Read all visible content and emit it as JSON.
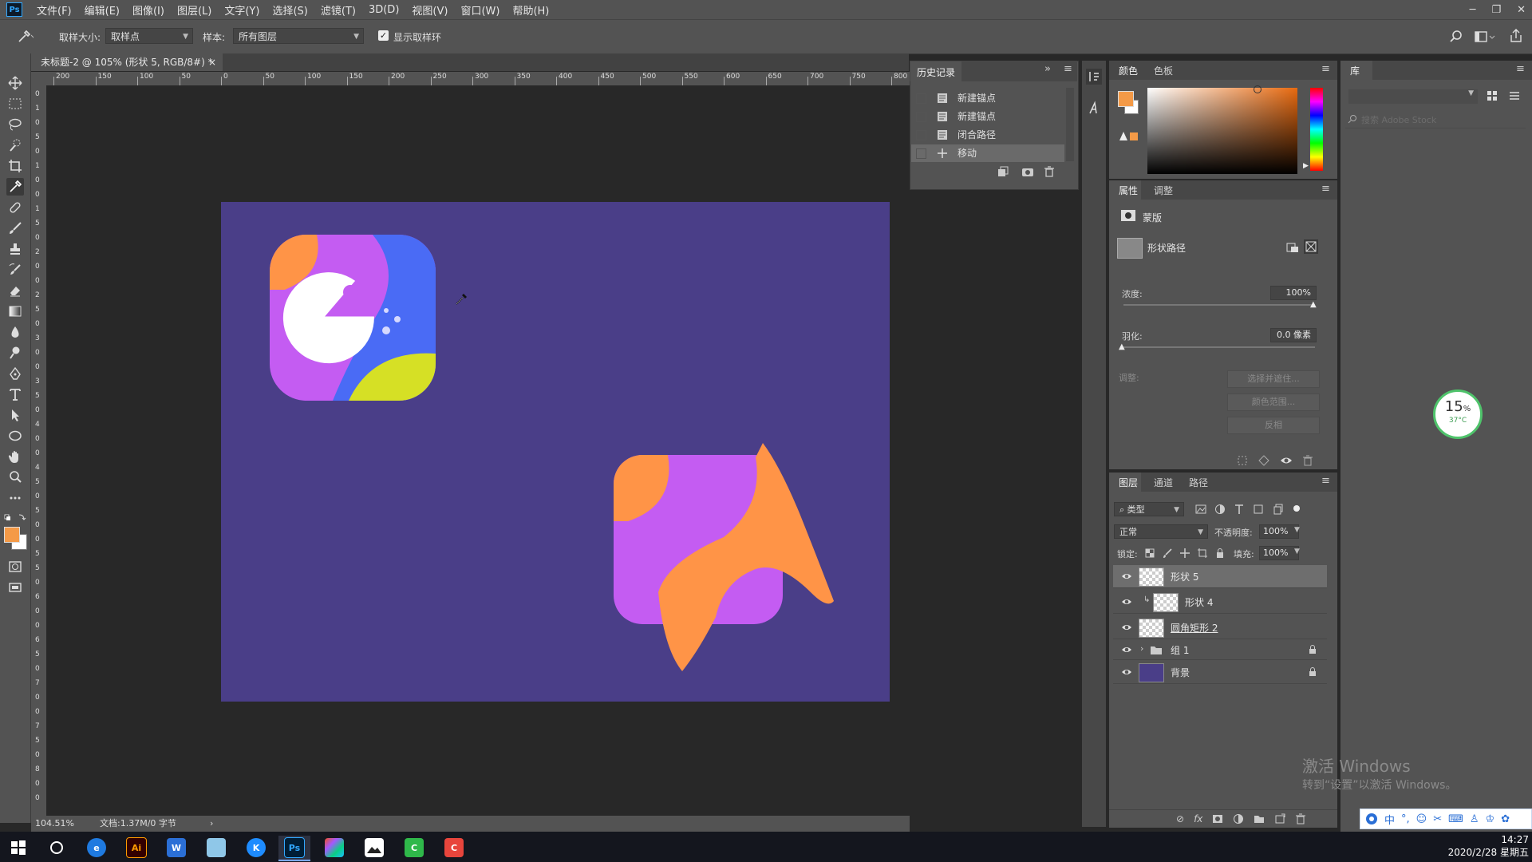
{
  "app": {
    "logo": "Ps"
  },
  "menu": [
    "文件(F)",
    "编辑(E)",
    "图像(I)",
    "图层(L)",
    "文字(Y)",
    "选择(S)",
    "滤镜(T)",
    "3D(D)",
    "视图(V)",
    "窗口(W)",
    "帮助(H)"
  ],
  "window_controls": {
    "minimize": "─",
    "restore": "❐",
    "close": "✕"
  },
  "options": {
    "sample_size_label": "取样大小:",
    "sample_size_value": "取样点",
    "sample_label": "样本:",
    "sample_value": "所有图层",
    "show_ring_label": "显示取样环",
    "show_ring_checked": true
  },
  "document": {
    "tab_title": "未标题-2 @ 105% (形状 5, RGB/8#) *",
    "tab_close": "×",
    "zoom": "104.51%",
    "doc_info": "文档:1.37M/0 字节",
    "status_arrow": "›"
  },
  "ruler": {
    "h_ticks": [
      "200",
      "150",
      "100",
      "50",
      "0",
      "50",
      "100",
      "150",
      "200",
      "250",
      "300",
      "350",
      "400",
      "450",
      "500",
      "550",
      "600",
      "650",
      "700",
      "750",
      "800"
    ],
    "v_ticks": [
      "0",
      "1",
      "0",
      "5",
      "0",
      "1",
      "0",
      "0",
      "1",
      "5",
      "0",
      "2",
      "0",
      "0",
      "2",
      "5",
      "0",
      "3",
      "0",
      "0",
      "3",
      "5",
      "0",
      "4",
      "0",
      "0",
      "4",
      "5",
      "0",
      "5",
      "0",
      "0",
      "5",
      "5",
      "0",
      "6",
      "0",
      "0",
      "6",
      "5",
      "0",
      "7",
      "0",
      "0",
      "7",
      "5",
      "0",
      "8",
      "0",
      "0"
    ]
  },
  "history": {
    "tab": "历史记录",
    "expand": "»",
    "items": [
      "新建锚点",
      "新建锚点",
      "闭合路径",
      "移动"
    ]
  },
  "color_panel": {
    "tabs": [
      "颜色",
      "色板"
    ],
    "foreground": "#f49a47",
    "background": "#ffffff",
    "hue_color": "#e86a10"
  },
  "library": {
    "tab": "库",
    "search_placeholder": "搜索 Adobe Stock"
  },
  "properties": {
    "tabs": [
      "属性",
      "调整"
    ],
    "mask_title": "蒙版",
    "shape_path_label": "形状路径",
    "density_label": "浓度:",
    "density_value": "100%",
    "feather_label": "羽化:",
    "feather_value": "0.0 像素",
    "adjust_label": "调整:",
    "btn_select_mask": "选择并遮住...",
    "btn_color_range": "颜色范围...",
    "btn_invert": "反相"
  },
  "layers_panel": {
    "tabs": [
      "图层",
      "通道",
      "路径"
    ],
    "filter": "类型",
    "blend_mode": "正常",
    "opacity_label": "不透明度:",
    "opacity": "100%",
    "lock_label": "锁定:",
    "fill_label": "填充:",
    "fill": "100%",
    "layers": [
      {
        "name": "形状 5",
        "selected": true
      },
      {
        "name": "形状 4",
        "selected": false
      },
      {
        "name": "圆角矩形 2",
        "selected": false
      },
      {
        "name": "组 1",
        "selected": false
      },
      {
        "name": "背景",
        "selected": false
      }
    ]
  },
  "perf_widget": {
    "percent": "15",
    "unit": "%",
    "temp": "37°C"
  },
  "watermark": {
    "line1": "激活 Windows",
    "line2": "转到“设置”以激活 Windows。"
  },
  "ime": {
    "mode": "中"
  },
  "taskbar": {
    "apps": [
      "Ai",
      "Ps"
    ],
    "time": "14:27",
    "date": "2020/2/28 星期五"
  },
  "colors": {
    "artboard": "#4a3e88",
    "orange": "#ff9447",
    "purple": "#c45cf2",
    "blue": "#4a6bf5",
    "yellow": "#d6e025"
  }
}
